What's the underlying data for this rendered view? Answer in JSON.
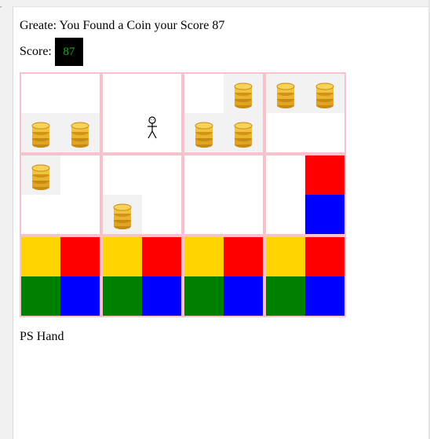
{
  "message": "Greate: You Found a Coin your Score 87",
  "score": {
    "label": "Score:",
    "value": "87",
    "value_color": "#22a622"
  },
  "colors": {
    "cell_border": "#f6c3cc",
    "coin_background": "#f2f2f2",
    "yellow": "#ffd400",
    "red": "#ff0000",
    "green": "#008000",
    "blue": "#0000ff"
  },
  "board": {
    "rows": 3,
    "cols": 4,
    "player": {
      "row": 1,
      "col": 2
    },
    "cells": [
      [
        "coin-bottom-left",
        "coin-bottom-right"
      ],
      [
        "player"
      ],
      [
        "coin-top-right",
        "coin-bottom-left",
        "coin-bottom-right"
      ],
      [
        "coin-top-left",
        "coin-top-right"
      ],
      [
        "coin-top-left"
      ],
      [
        "coin-bottom-left"
      ],
      [],
      [
        "red-top-right",
        "blue-bottom-right"
      ],
      [
        "yellow-top-left",
        "red-top-right",
        "green-bottom-left",
        "blue-bottom-right"
      ],
      [
        "yellow-top-left",
        "red-top-right",
        "green-bottom-left",
        "blue-bottom-right"
      ],
      [
        "yellow-top-left",
        "red-top-right",
        "green-bottom-left",
        "blue-bottom-right"
      ],
      [
        "yellow-top-left",
        "red-top-right",
        "green-bottom-left",
        "blue-bottom-right"
      ]
    ]
  },
  "caption": "PS Hand"
}
